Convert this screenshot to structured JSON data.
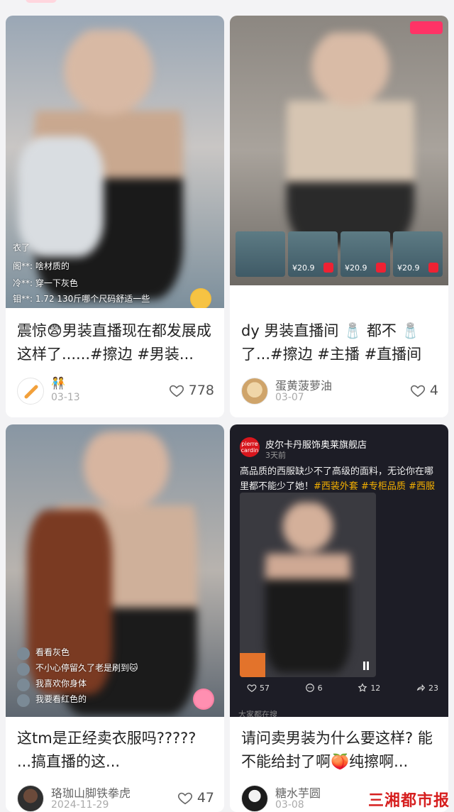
{
  "feed": {
    "cards": [
      {
        "title": "震惊😨男装直播现在都发展成这样了......#擦边 #男装...",
        "author": "🧑‍🤝‍🧑",
        "date": "03-13",
        "likes": "778",
        "overlay": {
          "lines": [
            "衣了",
            "阁**:  啥材质的",
            "冷**:  穿一下灰色",
            "钼**:  1.72  130斤哪个尺码舒适一些"
          ]
        }
      },
      {
        "title": "dy 男装直播间 🧂 都不 🧂 了...#擦边 #主播 #直播间",
        "author": "蛋黄菠萝油",
        "date": "03-07",
        "likes": "4",
        "overlay": {
          "prices": [
            "¥20.9",
            "¥20.9",
            "¥20.9",
            "¥20.9"
          ]
        }
      },
      {
        "title": "这tm是正经卖衣服吗?????  ...搞直播的这...",
        "author": "珞珈山脚铁拳虎",
        "date": "2024-11-29",
        "likes": "47",
        "overlay": {
          "comments": [
            "看看灰色",
            "不小心停留久了老是刷到🐱",
            "我喜欢你身体",
            "我要看红色的"
          ]
        }
      },
      {
        "title": "请问卖男装为什么要这样? 能不能给封了啊🍑纯擦啊...",
        "author": "糖水芋圆",
        "date": "03-08",
        "likes": "",
        "post": {
          "shop_name": "皮尔卡丹服饰奥莱旗舰店",
          "time": "3天前",
          "logo_text": "pierre cardin",
          "text": "高品质的西服缺少不了高级的面料，无论你在哪里都不能少了她！",
          "tags": "#西装外套 #专柜品质 #西服",
          "actions": [
            {
              "icon": "heart-icon",
              "count": "57"
            },
            {
              "icon": "comment-icon",
              "count": "6"
            },
            {
              "icon": "star-icon",
              "count": "12"
            },
            {
              "icon": "share-icon",
              "count": "23"
            }
          ],
          "footer": "大家都在搜"
        }
      }
    ],
    "watermark": "三湘都市报"
  },
  "colors": {
    "accent": "#ff3366",
    "watermark": "#d61f1f"
  }
}
